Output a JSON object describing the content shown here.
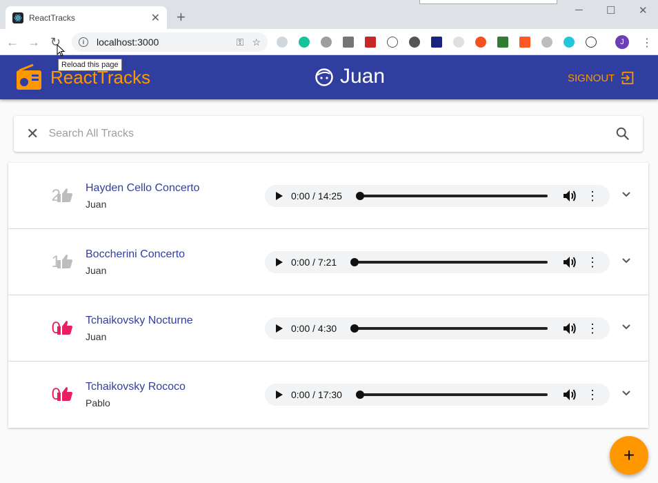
{
  "browser": {
    "tab_title": "ReactTracks",
    "tab_close": "✕",
    "new_tab": "+",
    "url": "localhost:3000",
    "tooltip": "Reload this page",
    "profile_initial": "J",
    "window_controls": [
      "─",
      "☐",
      "✕"
    ]
  },
  "app": {
    "brand": "ReactTracks",
    "user": "Juan",
    "signout_label": "SIGNOUT",
    "colors": {
      "primary": "#303f9f",
      "accent": "#ff9800",
      "liked": "#e91e63",
      "unliked": "#bdbdbd"
    }
  },
  "search": {
    "placeholder": "Search All Tracks",
    "value": ""
  },
  "tracks": [
    {
      "likes": "2",
      "liked": false,
      "title": "Hayden Cello Concerto",
      "user": "Juan",
      "time": "0:00 / 14:25"
    },
    {
      "likes": "1",
      "liked": false,
      "title": "Boccherini Concerto",
      "user": "Juan",
      "time": "0:00 / 7:21"
    },
    {
      "likes": "0",
      "liked": true,
      "title": "Tchaikovsky Nocturne",
      "user": "Juan",
      "time": "0:00 / 4:30"
    },
    {
      "likes": "0",
      "liked": true,
      "title": "Tchaikovsky Rococo",
      "user": "Pablo",
      "time": "0:00 / 17:30"
    }
  ],
  "fab_label": "+"
}
